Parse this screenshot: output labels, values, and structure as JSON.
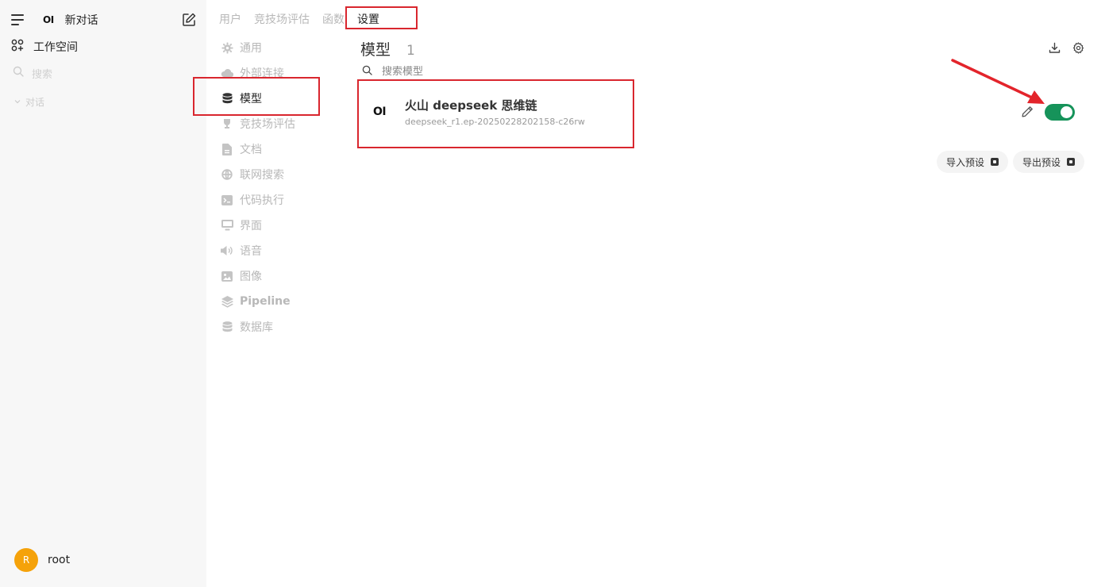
{
  "sidebar": {
    "logo": "OI",
    "new_chat": "新对话",
    "workspace": "工作空间",
    "search_placeholder": "搜索",
    "chats_label": "对话",
    "user": {
      "initial": "R",
      "name": "root"
    }
  },
  "tabs": [
    "用户",
    "竞技场评估",
    "函数",
    "设置"
  ],
  "settings_menu": [
    "通用",
    "外部连接",
    "模型",
    "竞技场评估",
    "文档",
    "联网搜索",
    "代码执行",
    "界面",
    "语音",
    "图像",
    "Pipeline",
    "数据库"
  ],
  "main": {
    "title": "模型",
    "count": "1",
    "search_placeholder": "搜索模型",
    "model": {
      "logo": "OI",
      "name": "火山 deepseek 思维链",
      "id": "deepseek_r1.ep-20250228202158-c26rw",
      "enabled": true
    },
    "import_label": "导入预设",
    "export_label": "导出预设"
  },
  "colors": {
    "toggle_on": "#16935a",
    "avatar": "#f5a20a",
    "annotation": "#d9262e"
  }
}
